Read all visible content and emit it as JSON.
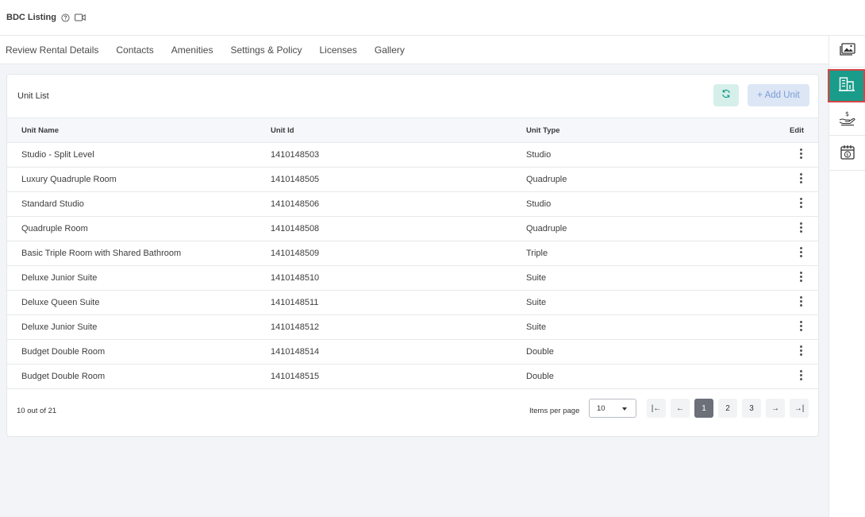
{
  "header": {
    "title": "BDC Listing",
    "help_icon": "help-circle-icon",
    "video_icon": "video-camera-icon"
  },
  "tabs": [
    {
      "label": "Review Rental Details"
    },
    {
      "label": "Contacts"
    },
    {
      "label": "Amenities"
    },
    {
      "label": "Settings & Policy"
    },
    {
      "label": "Licenses"
    },
    {
      "label": "Gallery"
    }
  ],
  "right_sidebar": {
    "items": [
      {
        "icon": "gallery-image-icon"
      },
      {
        "icon": "building-units-icon",
        "active": true
      },
      {
        "icon": "hand-dollar-icon"
      },
      {
        "icon": "calendar-dollar-icon"
      }
    ],
    "accent": "#1a9c8a",
    "highlight": "#d64545"
  },
  "unit_list": {
    "title": "Unit List",
    "refresh_icon": "refresh-icon",
    "add_button": "+ Add Unit",
    "columns": [
      "Unit Name",
      "Unit Id",
      "Unit Type",
      "Edit"
    ],
    "rows": [
      {
        "name": "Studio - Split Level",
        "id": "1410148503",
        "type": "Studio"
      },
      {
        "name": "Luxury Quadruple Room",
        "id": "1410148505",
        "type": "Quadruple"
      },
      {
        "name": "Standard Studio",
        "id": "1410148506",
        "type": "Studio"
      },
      {
        "name": "Quadruple Room",
        "id": "1410148508",
        "type": "Quadruple"
      },
      {
        "name": "Basic Triple Room with Shared Bathroom",
        "id": "1410148509",
        "type": "Triple"
      },
      {
        "name": "Deluxe Junior Suite",
        "id": "1410148510",
        "type": "Suite"
      },
      {
        "name": "Deluxe Queen Suite",
        "id": "1410148511",
        "type": "Suite"
      },
      {
        "name": "Deluxe Junior Suite",
        "id": "1410148512",
        "type": "Suite"
      },
      {
        "name": "Budget Double Room",
        "id": "1410148514",
        "type": "Double"
      },
      {
        "name": "Budget Double Room",
        "id": "1410148515",
        "type": "Double"
      }
    ]
  },
  "pagination": {
    "count_text": "10 out of 21",
    "items_per_page_label": "Items per page",
    "items_per_page_value": "10",
    "pages": [
      "1",
      "2",
      "3"
    ],
    "current_page": "1",
    "first_label": "|←",
    "prev_label": "←",
    "next_label": "→",
    "last_label": "→|"
  }
}
